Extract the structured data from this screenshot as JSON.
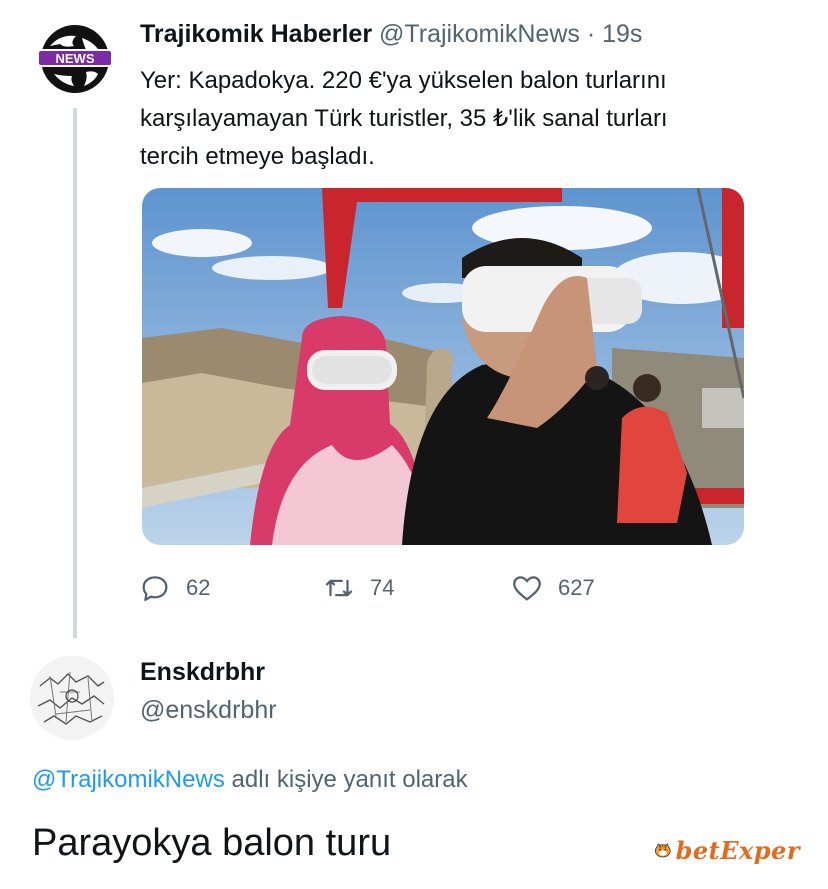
{
  "tweet": {
    "author_name": "Trajikomik Haberler",
    "author_handle": "@TrajikomikNews",
    "separator": "·",
    "time": "19s",
    "avatar_label": "NEWS",
    "lines": [
      "Yer: Kapadokya. 220 €'ya yükselen balon turlarını",
      "karşılayamayan Türk turistler, 35 ₺'lik sanal turları",
      "tercih etmeye başladı."
    ],
    "media_icon": "photo-vr-headsets-balloon-basket",
    "stats": {
      "replies": "62",
      "retweets": "74",
      "likes": "627"
    }
  },
  "reply": {
    "author_name": "Enskdrbhr",
    "author_handle": "@enskdrbhr",
    "replying_link": "@TrajikomikNews",
    "replying_suffix": " adlı kişiye yanıt olarak",
    "text": "Parayokya balon turu"
  },
  "watermark": {
    "text": "betExper"
  },
  "colors": {
    "text": "#0f1419",
    "secondary": "#536471",
    "link": "#1d9bf0",
    "thread_line": "#cfd9de",
    "watermark": "#e36a1f"
  }
}
